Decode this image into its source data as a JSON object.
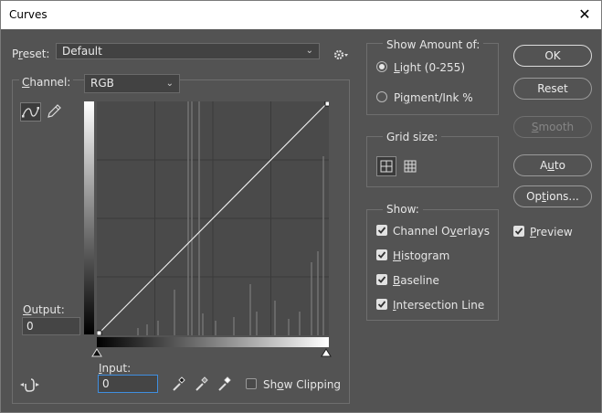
{
  "window": {
    "title": "Curves"
  },
  "preset": {
    "label_pre": "P",
    "label_u": "r",
    "label_post": "eset:",
    "value": "Default"
  },
  "channel": {
    "label_u": "C",
    "label_post": "hannel:",
    "value": "RGB"
  },
  "output": {
    "label_u": "O",
    "label_post": "utput:",
    "value": "0"
  },
  "input": {
    "label_u": "I",
    "label_post": "nput:",
    "value": "0"
  },
  "show_clipping": {
    "label_pre": "Sh",
    "label_u": "o",
    "label_post": "w Clipping",
    "checked": false
  },
  "show_amount": {
    "title": "Show Amount of:",
    "light": {
      "label_u": "L",
      "label_post": "ight  (0-255)",
      "selected": true
    },
    "pigment": {
      "label_pre": "Pi",
      "label_u": "g",
      "label_post": "ment/Ink %",
      "selected": false
    }
  },
  "grid_size": {
    "title": "Grid size:"
  },
  "show": {
    "title": "Show:",
    "channel_overlays": {
      "label_pre": "Channel O",
      "label_u": "v",
      "label_post": "erlays",
      "checked": true
    },
    "histogram": {
      "label_u": "H",
      "label_post": "istogram",
      "checked": true
    },
    "baseline": {
      "label_u": "B",
      "label_post": "aseline",
      "checked": true
    },
    "intersection": {
      "label_u": "I",
      "label_post": "ntersection Line",
      "checked": true
    }
  },
  "buttons": {
    "ok": "OK",
    "reset": "Reset",
    "smooth": {
      "label_u": "S",
      "label_post": "mooth",
      "disabled": true
    },
    "auto": {
      "label_pre": "A",
      "label_u": "u",
      "label_post": "to"
    },
    "options": {
      "label_pre": "Op",
      "label_u": "t",
      "label_post": "ions..."
    }
  },
  "preview": {
    "label_u": "P",
    "label_post": "review",
    "checked": true
  },
  "icons": [
    "curve-mode-icon",
    "pencil-icon",
    "settings-gear-icon",
    "target-adjust-icon",
    "black-point-eyedropper-icon",
    "gray-point-eyedropper-icon",
    "white-point-eyedropper-icon",
    "large-grid-icon",
    "small-grid-icon",
    "close-icon"
  ]
}
